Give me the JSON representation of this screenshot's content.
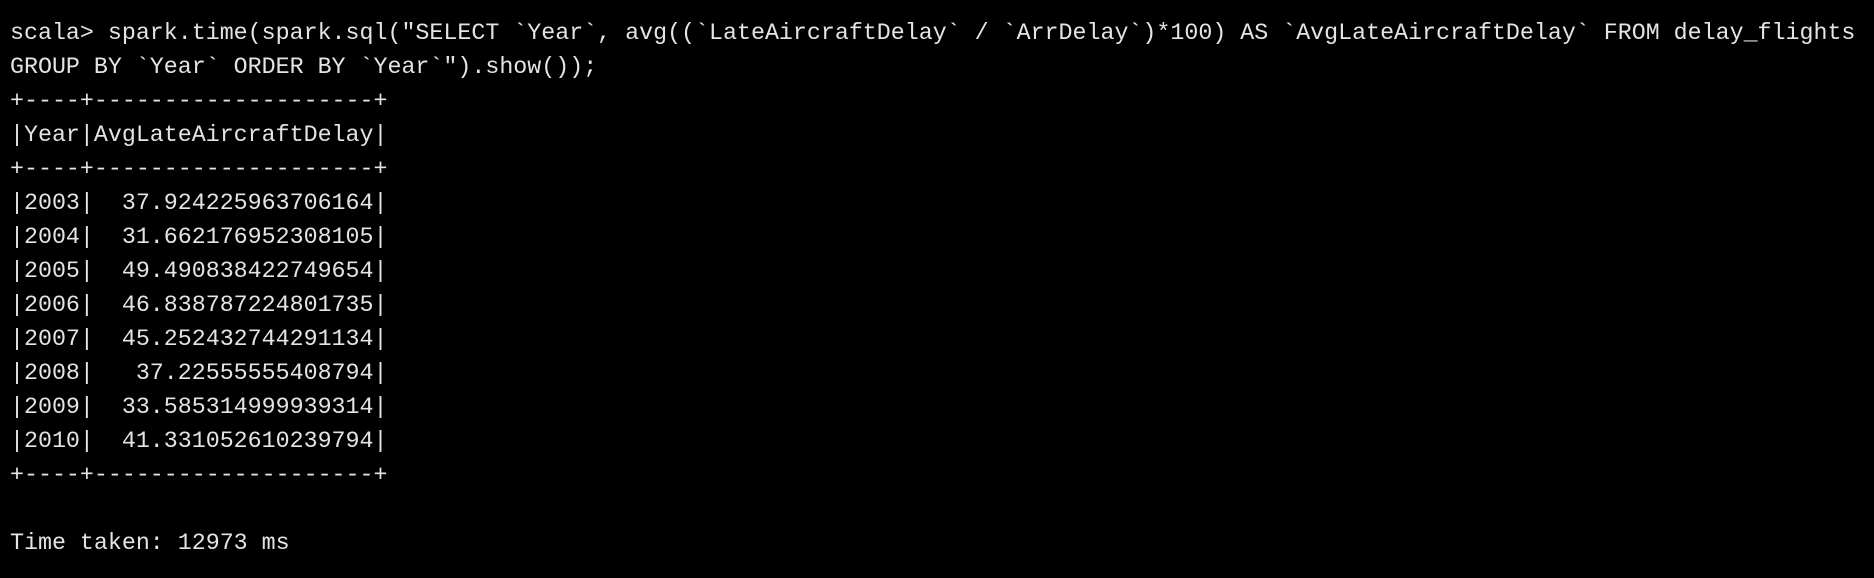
{
  "terminal": {
    "command_line_1": "scala> spark.time(spark.sql(\"SELECT `Year`, avg((`LateAircraftDelay` / `ArrDelay`)*100) AS `AvgLateAircraftDelay` FROM delay_flights",
    "command_line_2": "GROUP BY `Year` ORDER BY `Year`\").show());",
    "table": {
      "border": "+----+--------------------+",
      "header": "|Year|AvgLateAircraftDelay|",
      "columns": [
        "Year",
        "AvgLateAircraftDelay"
      ],
      "rows": [
        "|2003|  37.924225963706164|",
        "|2004|  31.662176952308105|",
        "|2005|  49.490838422749654|",
        "|2006|  46.838787224801735|",
        "|2007|  45.252432744291134|",
        "|2008|   37.22555555408794|",
        "|2009|  33.585314999939314|",
        "|2010|  41.331052610239794|"
      ]
    },
    "time_taken": "Time taken: 12973 ms",
    "colors": {
      "background": "#000000",
      "foreground": "#e4e4e4"
    }
  }
}
